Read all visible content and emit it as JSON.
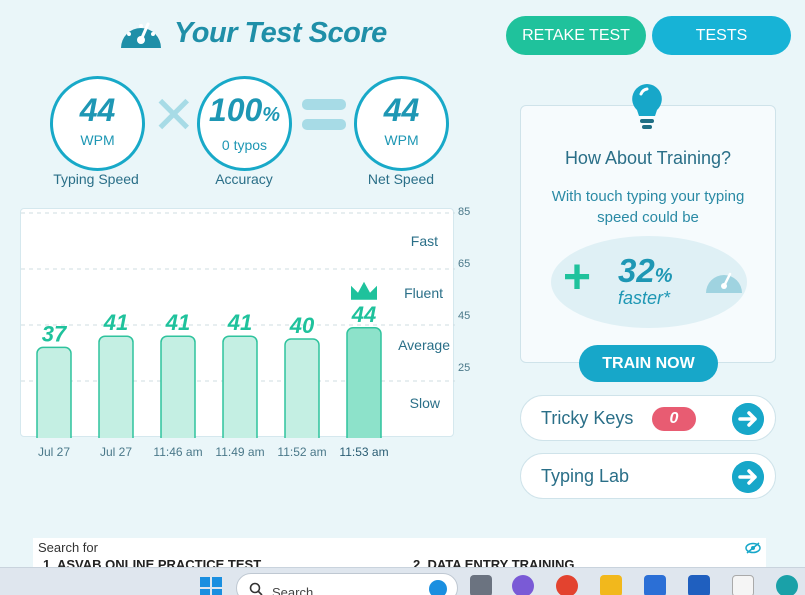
{
  "header": {
    "title": "Your Test Score",
    "retake_label": "RETAKE TEST",
    "tests_label": "TESTS"
  },
  "stats": {
    "speed": {
      "value": "44",
      "unit": "WPM",
      "label": "Typing Speed"
    },
    "accuracy": {
      "value": "100",
      "pct": "%",
      "unit": "0  typos",
      "label": "Accuracy"
    },
    "net": {
      "value": "44",
      "unit": "WPM",
      "label": "Net Speed"
    }
  },
  "chart_data": {
    "type": "bar",
    "categories": [
      "Jul 27",
      "Jul 27",
      "11:46 am",
      "11:49 am",
      "11:52 am",
      "11:53 am"
    ],
    "values": [
      37,
      41,
      41,
      41,
      40,
      44
    ],
    "highlight_index": 5,
    "ylim": [
      5,
      85
    ],
    "yticks": [
      "85",
      "65",
      "45",
      "25"
    ],
    "zones": [
      "Fast",
      "Fluent",
      "Average",
      "Slow"
    ],
    "grid": true
  },
  "training": {
    "title": "How About Training?",
    "text": "With touch typing your typing speed could be",
    "plus": "+",
    "value": "32",
    "pct": "%",
    "faster": "faster*",
    "button": "TRAIN NOW"
  },
  "rows": {
    "tricky_label": "Tricky Keys",
    "tricky_count": "0",
    "lab_label": "Typing Lab"
  },
  "ad": {
    "label": "Search for",
    "link1": "1. ASVAB ONLINE PRACTICE TEST",
    "link2": "2. DATA ENTRY TRAINING"
  },
  "taskbar": {
    "search_placeholder": "Search"
  },
  "colors": {
    "accent": "#1e97b4",
    "green": "#1fc29c",
    "bar_fill": "#c4efe3",
    "bar_highlight": "#8de2ca",
    "badge": "#e85c72"
  }
}
